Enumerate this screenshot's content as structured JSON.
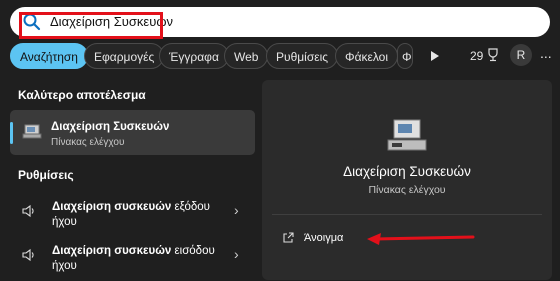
{
  "search": {
    "query": "Διαχείριση Συσκευών"
  },
  "filters": {
    "tabs": [
      "Αναζήτηση",
      "Εφαρμογές",
      "Έγγραφα",
      "Web",
      "Ρυθμίσεις",
      "Φάκελοι",
      "Φ"
    ],
    "points": "29",
    "avatar": "R",
    "more": "..."
  },
  "best_match": {
    "heading": "Καλύτερο αποτέλεσμα",
    "title": "Διαχείριση Συσκευών",
    "subtitle": "Πίνακας ελέγχου"
  },
  "settings": {
    "heading": "Ρυθμίσεις",
    "items": [
      {
        "bold": "Διαχείριση συσκευών",
        "rest": " εξόδου ήχου"
      },
      {
        "bold": "Διαχείριση συσκευών",
        "rest": " εισόδου ήχου"
      }
    ]
  },
  "preview": {
    "title": "Διαχείριση Συσκευών",
    "subtitle": "Πίνακας ελέγχου",
    "open_label": "Άνοιγμα"
  },
  "colors": {
    "accent": "#5cc4f2",
    "highlight": "#e3101a",
    "background": "#1f1f1f"
  }
}
